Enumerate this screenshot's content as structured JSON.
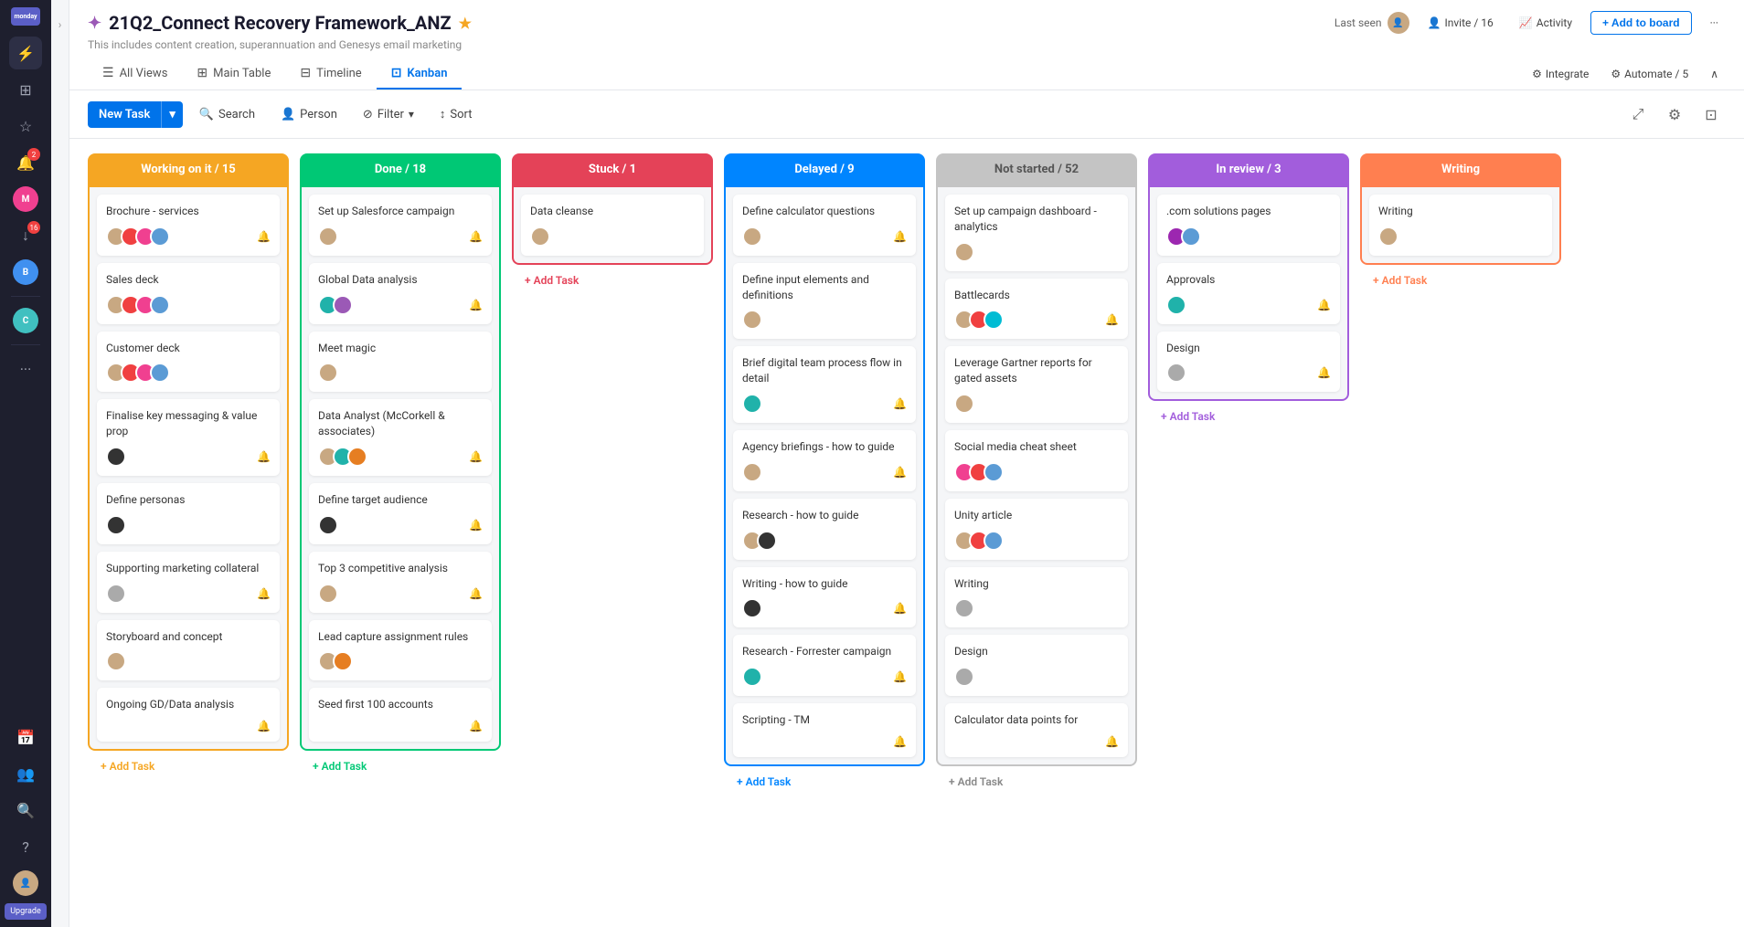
{
  "app": {
    "logo": "monday",
    "upgrade": "Upgrade"
  },
  "sidebar": {
    "icons": [
      {
        "name": "lightning-icon",
        "symbol": "⚡",
        "active": false
      },
      {
        "name": "grid-icon",
        "symbol": "⊞",
        "active": false
      },
      {
        "name": "star-icon",
        "symbol": "☆",
        "active": false
      },
      {
        "name": "bell-icon",
        "symbol": "🔔",
        "badge": "2",
        "active": false
      },
      {
        "name": "person-icon",
        "symbol": "M",
        "active": true,
        "color": "pink"
      },
      {
        "name": "download-icon",
        "symbol": "↓",
        "badge": "16",
        "active": false
      },
      {
        "name": "b-icon",
        "symbol": "B",
        "active": false,
        "color": "blue"
      },
      {
        "name": "c-icon",
        "symbol": "C",
        "active": false,
        "color": "cyan"
      },
      {
        "name": "calendar-icon",
        "symbol": "📅",
        "active": false
      },
      {
        "name": "people-icon",
        "symbol": "👥",
        "active": false
      },
      {
        "name": "search-icon",
        "symbol": "🔍",
        "active": false
      },
      {
        "name": "help-icon",
        "symbol": "?",
        "active": false
      }
    ]
  },
  "header": {
    "board_icon": "✦",
    "title": "21Q2_Connect Recovery Framework_ANZ",
    "star": "★",
    "subtitle": "This includes content creation, superannuation and Genesys email marketing",
    "last_seen_label": "Last seen",
    "invite_label": "Invite / 16",
    "activity_label": "Activity",
    "add_to_board": "+ Add to board",
    "more": "···"
  },
  "tabs": [
    {
      "id": "all-views",
      "label": "All Views",
      "icon": "☰",
      "active": false
    },
    {
      "id": "main-table",
      "label": "Main Table",
      "icon": "⊞",
      "active": false
    },
    {
      "id": "timeline",
      "label": "Timeline",
      "icon": "⊟",
      "active": false
    },
    {
      "id": "kanban",
      "label": "Kanban",
      "icon": "⊡",
      "active": true
    }
  ],
  "tabs_right": {
    "integrate": "Integrate",
    "automate": "Automate / 5",
    "collapse": "∧"
  },
  "toolbar": {
    "new_task": "New Task",
    "search": "Search",
    "person": "Person",
    "filter": "Filter",
    "sort": "Sort"
  },
  "columns": [
    {
      "id": "working",
      "label": "Working on it / 15",
      "color_class": "col-working",
      "add_label": "+ Add Task",
      "cards": [
        {
          "title": "Brochure - services",
          "avatars": [
            {
              "color": "brown"
            },
            {
              "color": "red"
            },
            {
              "color": "pink"
            },
            {
              "color": "lw"
            }
          ],
          "bell": true
        },
        {
          "title": "Sales deck",
          "avatars": [
            {
              "color": "brown"
            },
            {
              "color": "red"
            },
            {
              "color": "pink"
            },
            {
              "color": "lw"
            }
          ],
          "bell": false
        },
        {
          "title": "Customer deck",
          "avatars": [
            {
              "color": "brown"
            },
            {
              "color": "red"
            },
            {
              "color": "pink"
            },
            {
              "color": "lw"
            }
          ],
          "bell": false
        },
        {
          "title": "Finalise key messaging & value prop",
          "avatars": [
            {
              "color": "dark"
            }
          ],
          "bell": true
        },
        {
          "title": "Define personas",
          "avatars": [
            {
              "color": "dark"
            }
          ],
          "bell": false
        },
        {
          "title": "Supporting marketing collateral",
          "avatars": [
            {
              "color": "gray"
            }
          ],
          "bell": true
        },
        {
          "title": "Storyboard and concept",
          "avatars": [
            {
              "color": "brown"
            }
          ],
          "bell": false
        },
        {
          "title": "Ongoing GD/Data analysis",
          "avatars": [],
          "bell": true
        }
      ]
    },
    {
      "id": "done",
      "label": "Done / 18",
      "color_class": "col-done",
      "add_label": "+ Add Task",
      "cards": [
        {
          "title": "Set up Salesforce campaign",
          "avatars": [
            {
              "color": "brown"
            }
          ],
          "bell": true
        },
        {
          "title": "Global Data analysis",
          "avatars": [
            {
              "color": "teal"
            },
            {
              "color": "purple"
            }
          ],
          "bell": true
        },
        {
          "title": "Meet magic",
          "avatars": [
            {
              "color": "brown"
            }
          ],
          "bell": false
        },
        {
          "title": "Data Analyst (McCorkell & associates)",
          "avatars": [
            {
              "color": "brown"
            },
            {
              "color": "teal"
            },
            {
              "color": "orange"
            }
          ],
          "bell": true
        },
        {
          "title": "Define target audience",
          "avatars": [
            {
              "color": "dark"
            }
          ],
          "bell": true
        },
        {
          "title": "Top 3 competitive analysis",
          "avatars": [
            {
              "color": "brown"
            }
          ],
          "bell": true
        },
        {
          "title": "Lead capture assignment rules",
          "avatars": [
            {
              "color": "brown"
            },
            {
              "color": "orange"
            }
          ],
          "bell": false
        },
        {
          "title": "Seed first 100 accounts",
          "avatars": [],
          "bell": true
        }
      ]
    },
    {
      "id": "stuck",
      "label": "Stuck / 1",
      "color_class": "col-stuck",
      "add_label": "+ Add Task",
      "cards": [
        {
          "title": "Data cleanse",
          "avatars": [
            {
              "color": "brown"
            }
          ],
          "bell": false
        }
      ]
    },
    {
      "id": "delayed",
      "label": "Delayed / 9",
      "color_class": "col-delayed",
      "add_label": "+ Add Task",
      "cards": [
        {
          "title": "Define calculator questions",
          "avatars": [
            {
              "color": "brown"
            }
          ],
          "bell": true
        },
        {
          "title": "Define input elements and definitions",
          "avatars": [
            {
              "color": "brown"
            }
          ],
          "bell": false
        },
        {
          "title": "Brief digital team process flow in detail",
          "avatars": [
            {
              "color": "teal"
            }
          ],
          "bell": true
        },
        {
          "title": "Agency briefings - how to guide",
          "avatars": [
            {
              "color": "brown"
            }
          ],
          "bell": true
        },
        {
          "title": "Research - how to guide",
          "avatars": [
            {
              "color": "brown"
            },
            {
              "color": "dark"
            }
          ],
          "bell": false
        },
        {
          "title": "Writing - how to guide",
          "avatars": [
            {
              "color": "dark"
            }
          ],
          "bell": true
        },
        {
          "title": "Research - Forrester campaign",
          "avatars": [
            {
              "color": "teal"
            }
          ],
          "bell": true
        },
        {
          "title": "Scripting - TM",
          "avatars": [],
          "bell": true
        }
      ]
    },
    {
      "id": "notstarted",
      "label": "Not started / 52",
      "color_class": "col-notstarted",
      "add_label": "+ Add Task",
      "cards": [
        {
          "title": "Set up campaign dashboard - analytics",
          "avatars": [
            {
              "color": "brown"
            }
          ],
          "bell": false
        },
        {
          "title": "Battlecards",
          "avatars": [
            {
              "color": "brown"
            },
            {
              "color": "red"
            },
            {
              "color": "cyan"
            }
          ],
          "bell": true
        },
        {
          "title": "Leverage Gartner reports for gated assets",
          "avatars": [
            {
              "color": "brown"
            }
          ],
          "bell": false
        },
        {
          "title": "Social media cheat sheet",
          "avatars": [
            {
              "color": "pink"
            },
            {
              "color": "red"
            },
            {
              "color": "lw"
            }
          ],
          "bell": false
        },
        {
          "title": "Unity article",
          "avatars": [
            {
              "color": "brown"
            },
            {
              "color": "red"
            },
            {
              "color": "lw"
            }
          ],
          "bell": false
        },
        {
          "title": "Writing",
          "avatars": [
            {
              "color": "gray"
            }
          ],
          "bell": false
        },
        {
          "title": "Design",
          "avatars": [
            {
              "color": "gray"
            }
          ],
          "bell": false
        },
        {
          "title": "Calculator data points for",
          "avatars": [],
          "bell": true
        }
      ]
    },
    {
      "id": "inreview",
      "label": "In review / 3",
      "color_class": "col-inreview",
      "add_label": "+ Add Task",
      "cards": [
        {
          "title": ".com solutions pages",
          "avatars": [
            {
              "color": "am"
            },
            {
              "color": "lw"
            }
          ],
          "bell": false
        },
        {
          "title": "Approvals",
          "avatars": [
            {
              "color": "teal"
            }
          ],
          "bell": true
        },
        {
          "title": "Design",
          "avatars": [
            {
              "color": "gray"
            }
          ],
          "bell": true
        }
      ]
    },
    {
      "id": "writing",
      "label": "Writing",
      "color_class": "col-writing",
      "add_label": "+ Add Task",
      "cards": [
        {
          "title": "Writing",
          "avatars": [
            {
              "color": "brown"
            }
          ],
          "bell": false
        }
      ]
    }
  ]
}
